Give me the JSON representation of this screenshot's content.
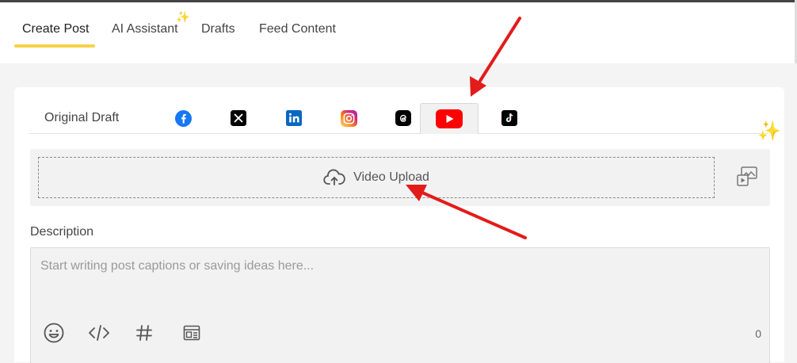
{
  "nav": {
    "tabs": [
      {
        "label": "Create Post"
      },
      {
        "label": "AI Assistant"
      },
      {
        "label": "Drafts"
      },
      {
        "label": "Feed Content"
      }
    ]
  },
  "platforms": {
    "original_label": "Original Draft",
    "icons": [
      "facebook-icon",
      "x-icon",
      "linkedin-icon",
      "instagram-icon",
      "threads-icon",
      "youtube-icon",
      "tiktok-icon"
    ],
    "selected": "youtube"
  },
  "upload": {
    "label": "Video Upload"
  },
  "description": {
    "label": "Description",
    "placeholder": "Start writing post captions or saving ideas here...",
    "char_count": "0"
  },
  "colors": {
    "accent_yellow": "#f7d24a",
    "youtube_red": "#ff0000",
    "facebook_blue": "#1877f2",
    "linkedin_blue": "#0a66c2",
    "annotation_red": "#e31b1b"
  }
}
